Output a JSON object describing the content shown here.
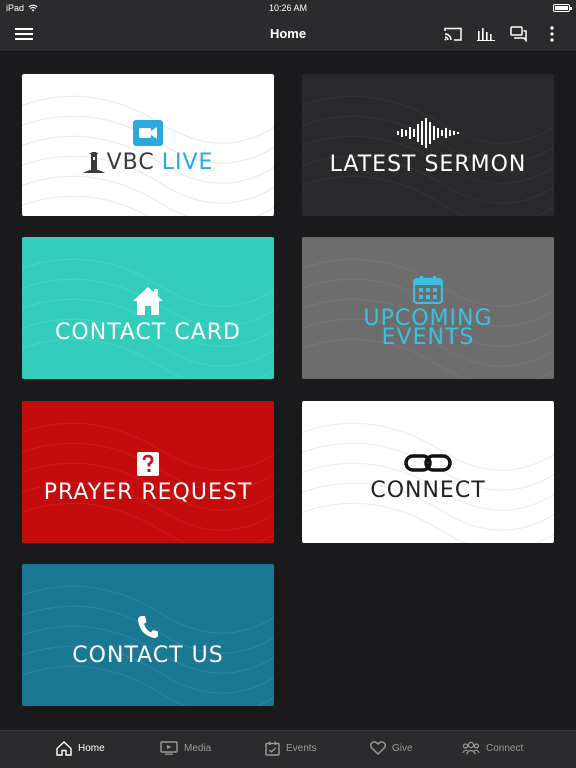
{
  "status": {
    "device": "iPad",
    "time": "10:26 AM"
  },
  "nav": {
    "title": "Home"
  },
  "tiles": {
    "vbc_live": {
      "brand": "VBC",
      "word": "LIVE",
      "brand_color": "#3a3a3a",
      "word_color": "#2aa8df"
    },
    "latest_sermon": {
      "label": "LATEST SERMON"
    },
    "contact_card": {
      "label": "CONTACT CARD"
    },
    "upcoming_events": {
      "line1": "UPCOMING",
      "line2": "EVENTS",
      "color": "#3bc1df"
    },
    "prayer_request": {
      "label": "PRAYER REQUEST"
    },
    "connect": {
      "label": "CONNECT"
    },
    "contact_us": {
      "label": "CONTACT US"
    }
  },
  "tabs": [
    {
      "label": "Home",
      "icon": "home-icon",
      "active": true
    },
    {
      "label": "Media",
      "icon": "tv-icon",
      "active": false
    },
    {
      "label": "Events",
      "icon": "calendar-icon",
      "active": false
    },
    {
      "label": "Give",
      "icon": "heart-icon",
      "active": false
    },
    {
      "label": "Connect",
      "icon": "people-icon",
      "active": false
    }
  ]
}
